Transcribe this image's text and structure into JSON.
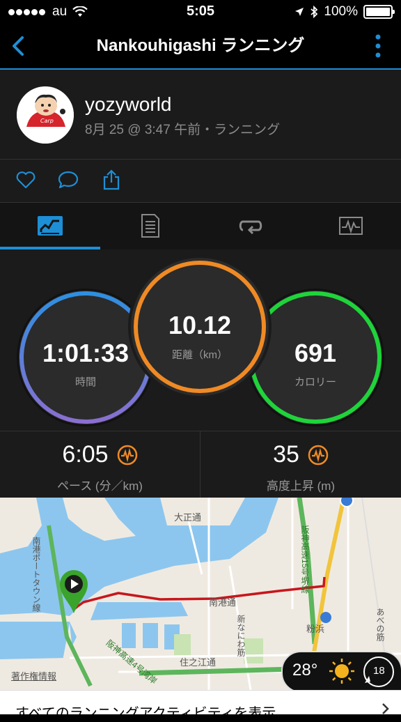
{
  "status": {
    "carrier": "au",
    "time": "5:05",
    "battery": "100%"
  },
  "nav": {
    "title": "Nankouhigashi ランニング"
  },
  "profile": {
    "username": "yozyworld",
    "meta": "8月 25 @ 3:47 午前・ランニング"
  },
  "tabs": [
    {
      "icon": "summary-chart-icon"
    },
    {
      "icon": "details-list-icon"
    },
    {
      "icon": "laps-loop-icon"
    },
    {
      "icon": "graph-monitor-icon"
    }
  ],
  "stats": {
    "time": {
      "value": "1:01:33",
      "label": "時間",
      "color": "#7f6cd0"
    },
    "distance": {
      "value": "10.12",
      "label": "距離（km）",
      "color": "#f08a24"
    },
    "calories": {
      "value": "691",
      "label": "カロリー",
      "color": "#1fd43a"
    },
    "pace": {
      "value": "6:05",
      "label": "ペース (分／km)"
    },
    "elevation": {
      "value": "35",
      "label": "高度上昇 (m)"
    }
  },
  "map": {
    "labels": {
      "daisho": "大正通",
      "minamiko_dori": "南港通",
      "hanshin15": "阪神高速15号堺線",
      "hanshin4": "阪神高速4号湾岸",
      "suminoe": "住之江通",
      "shinnaniwa": "新なにわ筋",
      "nanko_port": "南港ポートタウン線",
      "kohama": "粉浜",
      "abeno": "あべの筋",
      "copyright": "著作権情報"
    },
    "weather": {
      "temp": "28°",
      "wind": "18"
    }
  },
  "footer": {
    "link": "すべてのランニングアクティビティを表示"
  },
  "colors": {
    "accent": "#1d8fd6",
    "route": "#c8161d",
    "marker": "#3aa32c"
  }
}
